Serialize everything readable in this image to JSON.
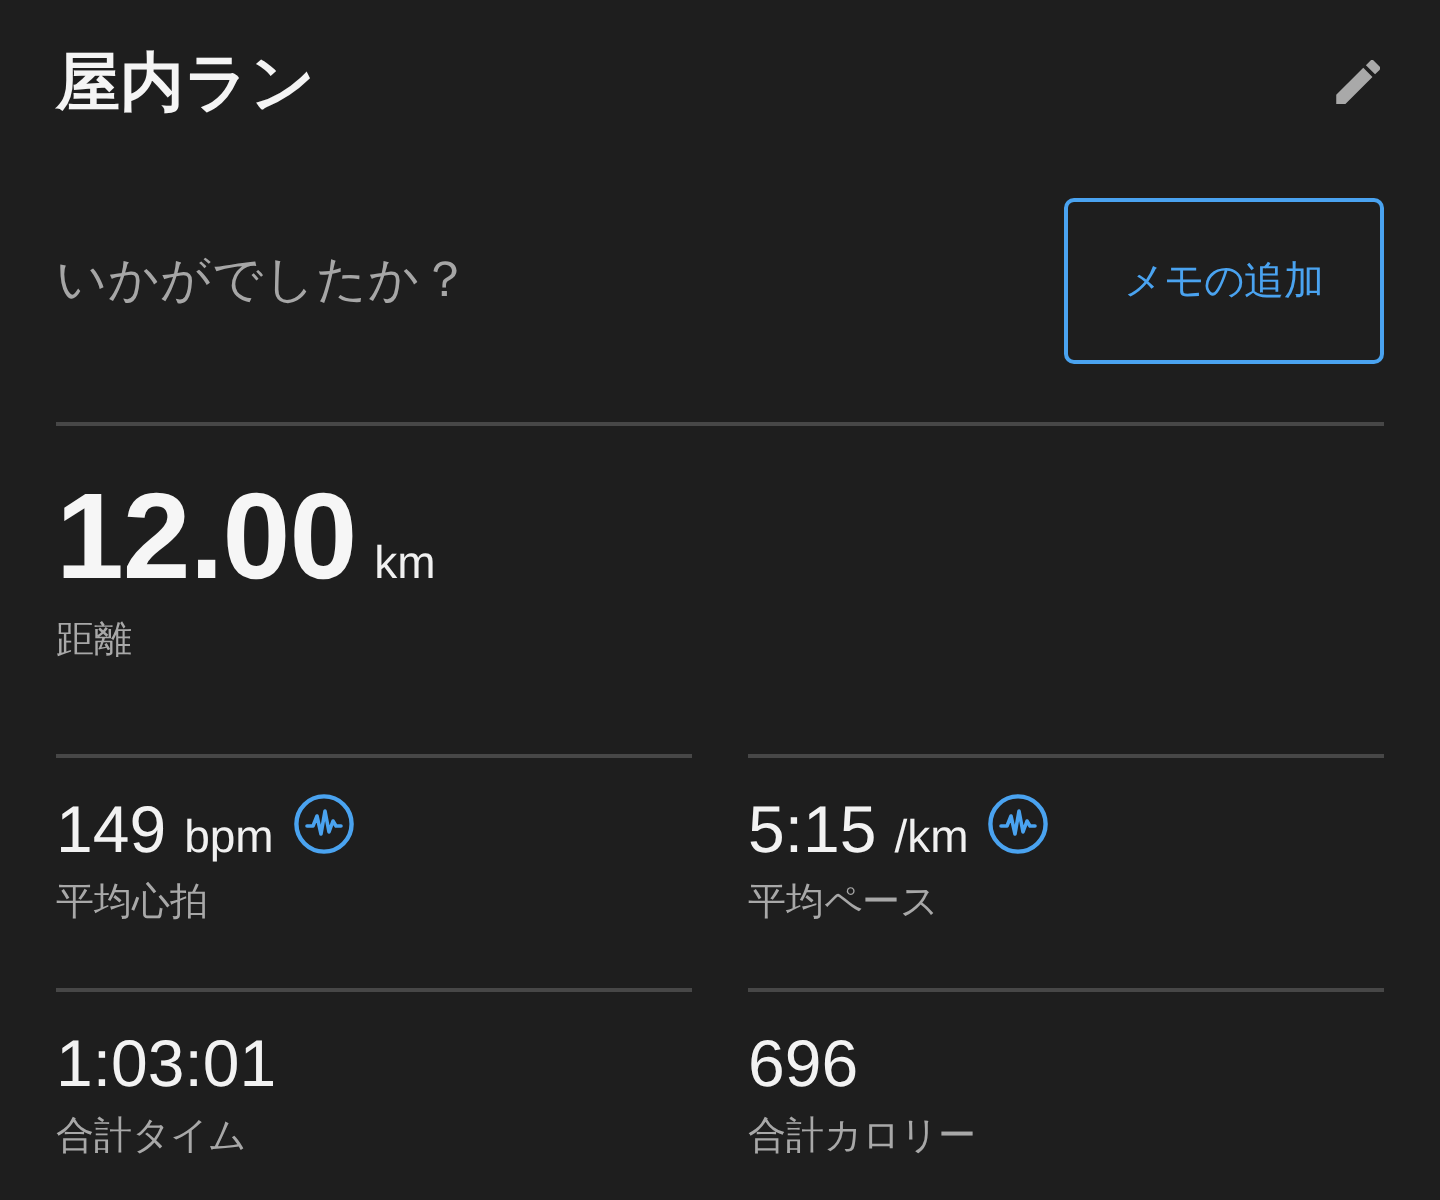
{
  "header": {
    "title": "屋内ラン"
  },
  "feedback": {
    "prompt": "いかがでしたか？",
    "button": "メモの追加"
  },
  "distance": {
    "value": "12.00",
    "unit": "km",
    "label": "距離"
  },
  "stats": [
    {
      "value": "149",
      "unit": "bpm",
      "label": "平均心拍",
      "graph": true
    },
    {
      "value": "5:15",
      "unit": "/km",
      "label": "平均ペース",
      "graph": true
    },
    {
      "value": "1:03:01",
      "label": "合計タイム",
      "graph": false
    },
    {
      "value": "696",
      "label": "合計カロリー",
      "graph": false
    }
  ]
}
